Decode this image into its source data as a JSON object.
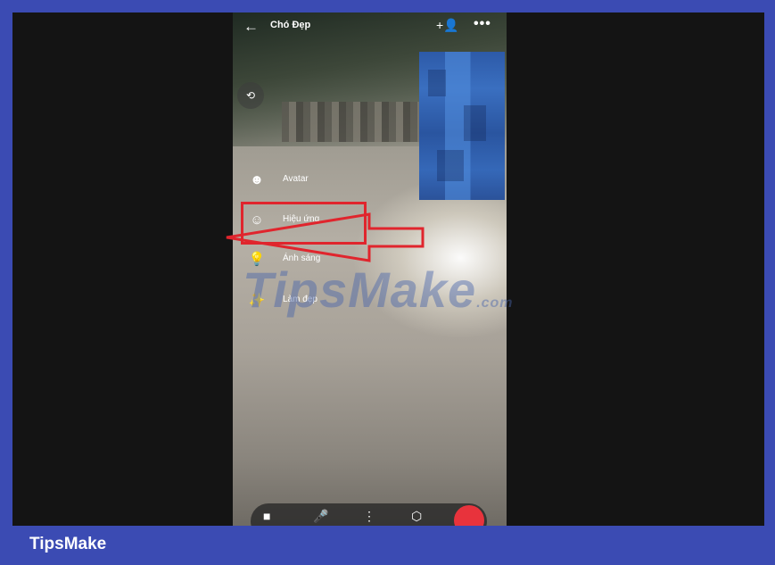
{
  "call": {
    "back_icon": "←",
    "contact_name": "Chó Đẹp",
    "add_person_icon": "+👤",
    "more_icon": "•••",
    "camera_switch_icon": "⟲"
  },
  "menu": {
    "items": [
      {
        "icon": "avatar-icon",
        "glyph": "☻",
        "label": "Avatar"
      },
      {
        "icon": "effects-icon",
        "glyph": "☺",
        "label": "Hiệu ứng"
      },
      {
        "icon": "lighting-icon",
        "glyph": "💡",
        "label": "Ánh sáng"
      },
      {
        "icon": "touch-up-icon",
        "glyph": "✨",
        "label": "Làm đẹp"
      }
    ]
  },
  "bottom_bar": {
    "icons": [
      "video-camera-icon",
      "microphone-icon",
      "share-screen-icon",
      "gift-icon",
      "end-call-icon"
    ],
    "glyphs": [
      "■",
      "🎤",
      "⋮",
      "⬡"
    ]
  },
  "watermark": {
    "main": "TipsMake",
    "suffix": ".com"
  },
  "footer": {
    "brand": "TipsMake"
  },
  "colors": {
    "frame_border": "#3b4bb3",
    "highlight": "#e0252d",
    "end_call": "#e8333c"
  }
}
